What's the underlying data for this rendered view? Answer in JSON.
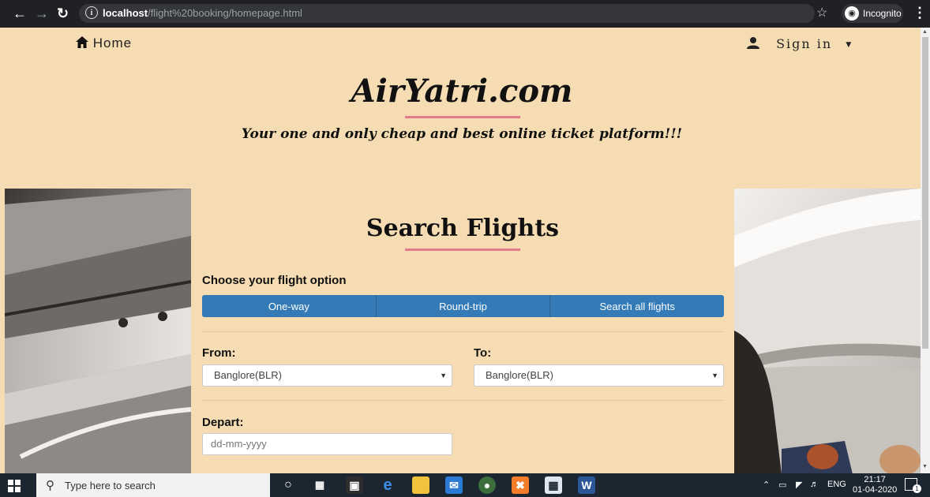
{
  "browser": {
    "url_host": "localhost",
    "url_path": "/flight%20booking/homepage.html",
    "incognito_label": "Incognito"
  },
  "nav": {
    "home_label": "Home",
    "signin_label": "Sign in"
  },
  "hero": {
    "site_title": "AirYatri.com",
    "tagline": "Your one and only cheap and best online ticket platform!!!"
  },
  "search_form": {
    "title": "Search Flights",
    "choose_label": "Choose your flight option",
    "options": [
      "One-way",
      "Round-trip",
      "Search all flights"
    ],
    "from_label": "From:",
    "from_value": "Banglore(BLR)",
    "to_label": "To:",
    "to_value": "Banglore(BLR)",
    "depart_label": "Depart:",
    "depart_placeholder": "dd-mm-yyyy"
  },
  "taskbar": {
    "search_placeholder": "Type here to search",
    "language": "ENG",
    "time": "21:17",
    "date": "01-04-2020",
    "notification_count": "1"
  },
  "colors": {
    "page_bg": "#f5dcb2",
    "accent_line": "#e07a8c",
    "button_blue": "#337ab7"
  }
}
